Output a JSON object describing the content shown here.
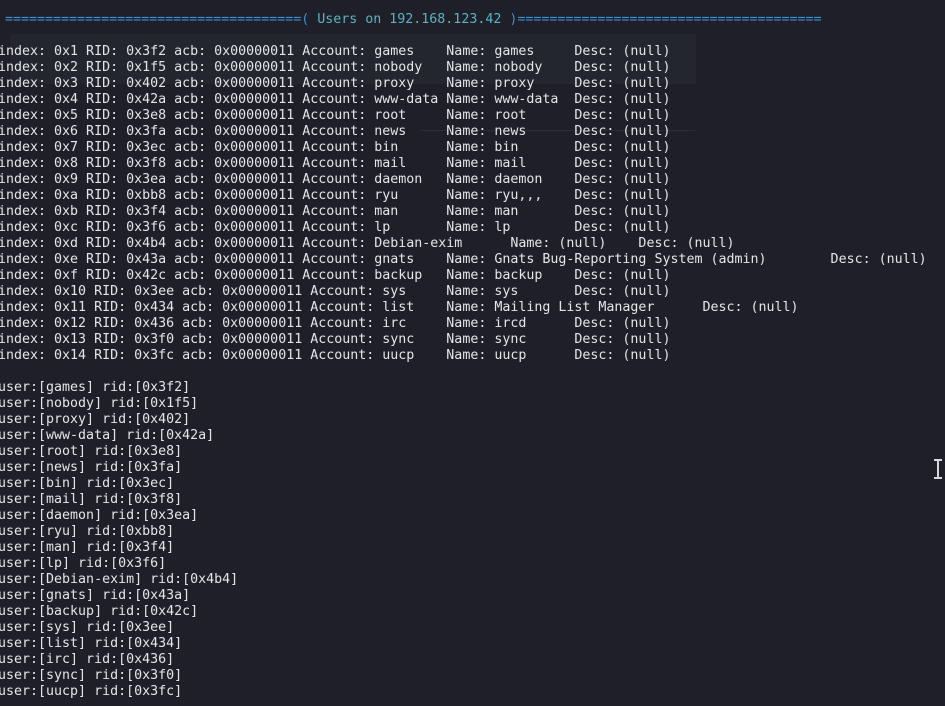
{
  "terminal": {
    "header": {
      "left_rule": "=====================================",
      "open": "( ",
      "title": "Users on 192.168.123.42",
      "close": " )",
      "right_rule": "======================================"
    },
    "enum_lines": [
      "index: 0x1 RID: 0x3f2 acb: 0x00000011 Account: games    Name: games     Desc: (null)",
      "index: 0x2 RID: 0x1f5 acb: 0x00000011 Account: nobody   Name: nobody    Desc: (null)",
      "index: 0x3 RID: 0x402 acb: 0x00000011 Account: proxy    Name: proxy     Desc: (null)",
      "index: 0x4 RID: 0x42a acb: 0x00000011 Account: www-data Name: www-data  Desc: (null)",
      "index: 0x5 RID: 0x3e8 acb: 0x00000011 Account: root     Name: root      Desc: (null)",
      "index: 0x6 RID: 0x3fa acb: 0x00000011 Account: news     Name: news      Desc: (null)",
      "index: 0x7 RID: 0x3ec acb: 0x00000011 Account: bin      Name: bin       Desc: (null)",
      "index: 0x8 RID: 0x3f8 acb: 0x00000011 Account: mail     Name: mail      Desc: (null)",
      "index: 0x9 RID: 0x3ea acb: 0x00000011 Account: daemon   Name: daemon    Desc: (null)",
      "index: 0xa RID: 0xbb8 acb: 0x00000011 Account: ryu      Name: ryu,,,    Desc: (null)",
      "index: 0xb RID: 0x3f4 acb: 0x00000011 Account: man      Name: man       Desc: (null)",
      "index: 0xc RID: 0x3f6 acb: 0x00000011 Account: lp       Name: lp        Desc: (null)",
      "index: 0xd RID: 0x4b4 acb: 0x00000011 Account: Debian-exim      Name: (null)    Desc: (null)",
      "index: 0xe RID: 0x43a acb: 0x00000011 Account: gnats    Name: Gnats Bug-Reporting System (admin)        Desc: (null)",
      "index: 0xf RID: 0x42c acb: 0x00000011 Account: backup   Name: backup    Desc: (null)",
      "index: 0x10 RID: 0x3ee acb: 0x00000011 Account: sys     Name: sys       Desc: (null)",
      "index: 0x11 RID: 0x434 acb: 0x00000011 Account: list    Name: Mailing List Manager      Desc: (null)",
      "index: 0x12 RID: 0x436 acb: 0x00000011 Account: irc     Name: ircd      Desc: (null)",
      "index: 0x13 RID: 0x3f0 acb: 0x00000011 Account: sync    Name: sync      Desc: (null)",
      "index: 0x14 RID: 0x3fc acb: 0x00000011 Account: uucp    Name: uucp      Desc: (null)"
    ],
    "user_lines": [
      "user:[games] rid:[0x3f2]",
      "user:[nobody] rid:[0x1f5]",
      "user:[proxy] rid:[0x402]",
      "user:[www-data] rid:[0x42a]",
      "user:[root] rid:[0x3e8]",
      "user:[news] rid:[0x3fa]",
      "user:[bin] rid:[0x3ec]",
      "user:[mail] rid:[0x3f8]",
      "user:[daemon] rid:[0x3ea]",
      "user:[ryu] rid:[0xbb8]",
      "user:[man] rid:[0x3f4]",
      "user:[lp] rid:[0x3f6]",
      "user:[Debian-exim] rid:[0x4b4]",
      "user:[gnats] rid:[0x43a]",
      "user:[backup] rid:[0x42c]",
      "user:[sys] rid:[0x3ee]",
      "user:[list] rid:[0x434]",
      "user:[irc] rid:[0x436]",
      "user:[sync] rid:[0x3f0]",
      "user:[uucp] rid:[0x3fc]"
    ],
    "cursor_icon": "text-cursor-ibeam-icon",
    "colors": {
      "background": "#1e1f29",
      "text": "#e6e6e6",
      "rule": "#3f8fd2",
      "host": "#56b6c2"
    }
  }
}
